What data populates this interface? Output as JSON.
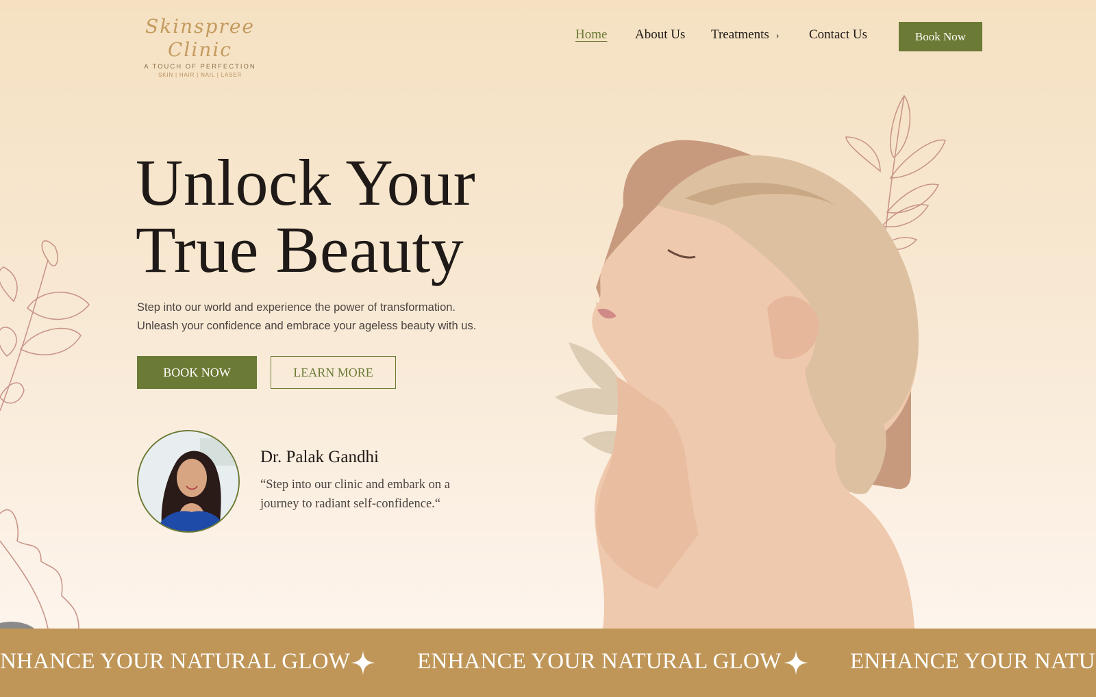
{
  "logo": {
    "title": "Skinspree Clinic",
    "tagline": "A TOUCH OF PERFECTION",
    "services": "SKIN | HAIR | NAIL | LASER"
  },
  "nav": {
    "items": [
      {
        "label": "Home",
        "active": true
      },
      {
        "label": "About Us",
        "active": false
      },
      {
        "label": "Treatments",
        "active": false,
        "has_submenu": true
      },
      {
        "label": "Contact Us",
        "active": false
      }
    ],
    "chevron": "›",
    "book_label": "Book Now"
  },
  "hero": {
    "title_line1": "Unlock Your",
    "title_line2": "True Beauty",
    "subtitle_line1": "Step into our world and experience the power of transformation.",
    "subtitle_line2": "Unleash your confidence and embrace your ageless beauty with us.",
    "primary_button": "BOOK NOW",
    "secondary_button": "LEARN MORE"
  },
  "doctor": {
    "name": "Dr. Palak Gandhi",
    "quote_line1": "“Step into our clinic and embark on a",
    "quote_line2": "journey to radiant self-confidence.“"
  },
  "marquee": {
    "text": "ENHANCE YOUR NATURAL GLOW",
    "text_partial_start": "NHANCE YOUR NATURAL GLOW",
    "text_partial_end": "ENHANCE YOUR NATURA"
  },
  "colors": {
    "accent_green": "#6b7a34",
    "gold": "#bf9658",
    "blob": "#c79a7e"
  },
  "icons": [
    "chevron-right-icon",
    "sparkle-star-icon"
  ]
}
